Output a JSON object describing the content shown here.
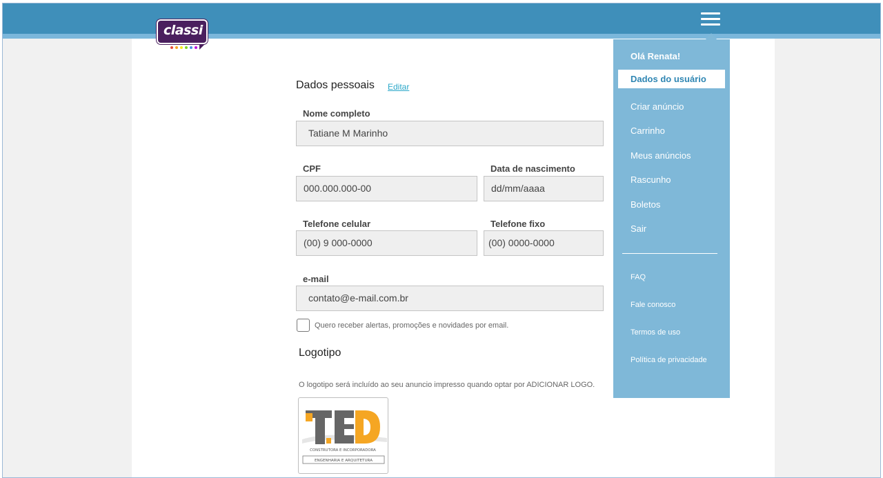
{
  "brand": {
    "logo_text": "classi"
  },
  "form": {
    "section_title": "Dados pessoais",
    "edit_link": "Editar",
    "fields": {
      "full_name": {
        "label": "Nome completo",
        "value": "Tatiane M Marinho"
      },
      "cpf": {
        "label": "CPF",
        "value": "000.000.000-00"
      },
      "birthdate": {
        "label": "Data de nascimento",
        "value": "dd/mm/aaaa"
      },
      "mobile": {
        "label": "Telefone celular",
        "value": "(00) 9 000-0000"
      },
      "landline": {
        "label": "Telefone fixo",
        "value": "(00) 0000-0000"
      },
      "email": {
        "label": "e-mail",
        "value": "contato@e-mail.com.br"
      }
    },
    "newsletter_checkbox": {
      "label": "Quero receber alertas, promoções e novidades por email.",
      "checked": false
    }
  },
  "logo_section": {
    "title": "Logotipo",
    "description": "O logotipo será incluído ao seu anuncio impresso quando optar por ADICIONAR LOGO.",
    "logo_image": {
      "letters": "TED",
      "line1": "CONSTRUTORA E INCORPORADORA",
      "line2": "ENGENHARIA E ARQUITETURA"
    }
  },
  "menu": {
    "greeting": "Olá Renata!",
    "active_item": "Dados do usuário",
    "items": [
      "Criar anúncio",
      "Carrinho",
      "Meus anúncios",
      "Rascunho",
      "Boletos",
      "Sair"
    ],
    "secondary_items": [
      "FAQ",
      "Fale conosco",
      "Termos de uso",
      "Política de privacidade"
    ]
  },
  "colors": {
    "header": "#3f8fba",
    "menu_bg": "#7fb8d8",
    "accent_link": "#2aa7c9",
    "brand_purple": "#4a1f5e",
    "logo_orange": "#f5a623"
  }
}
